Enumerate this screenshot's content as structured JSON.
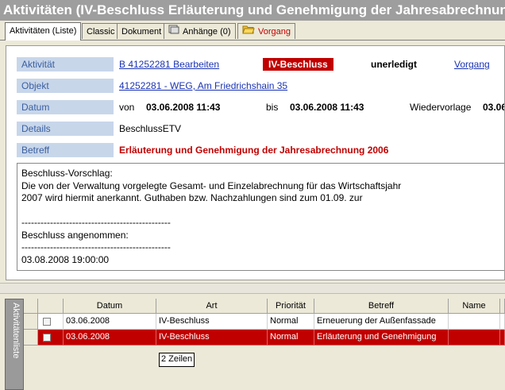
{
  "window": {
    "title": "Aktivitäten (IV-Beschluss Erläuterung und Genehmigung der Jahresabrechnung"
  },
  "tabs": [
    {
      "label": "Aktivitäten (Liste)"
    },
    {
      "label": "Classic"
    },
    {
      "label": "Dokument"
    },
    {
      "label": "Anhänge (0)"
    },
    {
      "label": "Vorgang"
    }
  ],
  "details": {
    "aktivitaet_label": "Aktivität",
    "aktivitaet_link": "B 41252281  Bearbeiten",
    "badge": "IV-Beschluss",
    "status": "unerledigt",
    "vorgang_link": "Vorgang",
    "objekt_label": "Objekt",
    "objekt_link": "41252281 - WEG, Am Friedrichshain 35",
    "datum_label": "Datum",
    "von_label": "von",
    "von_value": "03.06.2008 11:43",
    "bis_label": "bis",
    "bis_value": "03.06.2008 11:43",
    "wiedervorlage_label": "Wiedervorlage",
    "wiedervorlage_value": "03.06",
    "details_label": "Details",
    "details_value": "BeschlussETV",
    "betreff_label": "Betreff",
    "betreff_value": "Erläuterung und Genehmigung der Jahresabrechnung 2006",
    "body_text": "Beschluss-Vorschlag:\nDie von der Verwaltung vorgelegte Gesamt- und Einzelabrechnung für das Wirtschaftsjahr\n2007 wird hiermit anerkannt. Guthaben bzw. Nachzahlungen sind zum 01.09. zur\n\n-----------------------------------------------\nBeschluss angenommen:\n-----------------------------------------------\n03.08.2008 19:00:00"
  },
  "side_tab": {
    "label": "Aktivitätenliste"
  },
  "table": {
    "headers": [
      "Datum",
      "Art",
      "Priorität",
      "Betreff",
      "Name"
    ],
    "rows": [
      [
        "03.06.2008",
        "IV-Beschluss",
        "Normal",
        "Erneuerung der Außenfassade",
        ""
      ],
      [
        "03.06.2008",
        "IV-Beschluss",
        "Normal",
        "Erläuterung und Genehmigung",
        ""
      ]
    ]
  },
  "tooltip": {
    "text": "2 Zeilen"
  },
  "colors": {
    "accent_red": "#c00000",
    "label_bg": "#c8d6ea",
    "link": "#1a33b4"
  }
}
